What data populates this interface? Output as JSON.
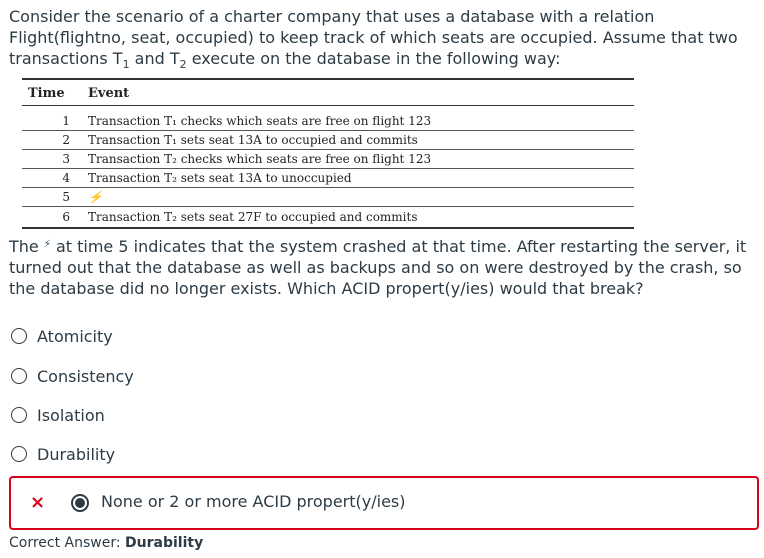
{
  "intro": {
    "part1": "Consider the scenario of a charter company that uses a database with a relation Flight(flightno, seat, occupied) to keep track of which seats are occupied. Assume that two transactions T",
    "sub1": "1",
    "part2": " and T",
    "sub2": "2",
    "part3": " execute on the database in the following way:"
  },
  "table": {
    "headers": [
      "Time",
      "Event"
    ],
    "rows": [
      {
        "time": "1",
        "event": "Transaction T₁ checks which seats are free on flight 123"
      },
      {
        "time": "2",
        "event": "Transaction T₁ sets seat 13A to occupied and commits"
      },
      {
        "time": "3",
        "event": "Transaction T₂ checks which seats are free on flight 123"
      },
      {
        "time": "4",
        "event": "Transaction T₂ sets seat 13A to unoccupied"
      },
      {
        "time": "5",
        "event": "⚡"
      },
      {
        "time": "6",
        "event": "Transaction T₂ sets seat 27F to occupied and commits"
      }
    ]
  },
  "question": {
    "before_bolt": "The ",
    "bolt": "⚡",
    "after_bolt": " at time 5 indicates that the system crashed at that time. After restarting the server, it turned out that the database as well as backups and so on were destroyed by the crash, so the database did no longer exists. Which ACID propert(y/ies) would that break?"
  },
  "options": [
    "Atomicity",
    "Consistency",
    "Isolation",
    "Durability"
  ],
  "selected_answer": {
    "mark": "×",
    "label": "None or 2 or more ACID propert(y/ies)"
  },
  "correct": {
    "label": "Correct Answer:",
    "value": "Durability"
  },
  "colors": {
    "text": "#2d3b45",
    "error": "#d9001b"
  }
}
